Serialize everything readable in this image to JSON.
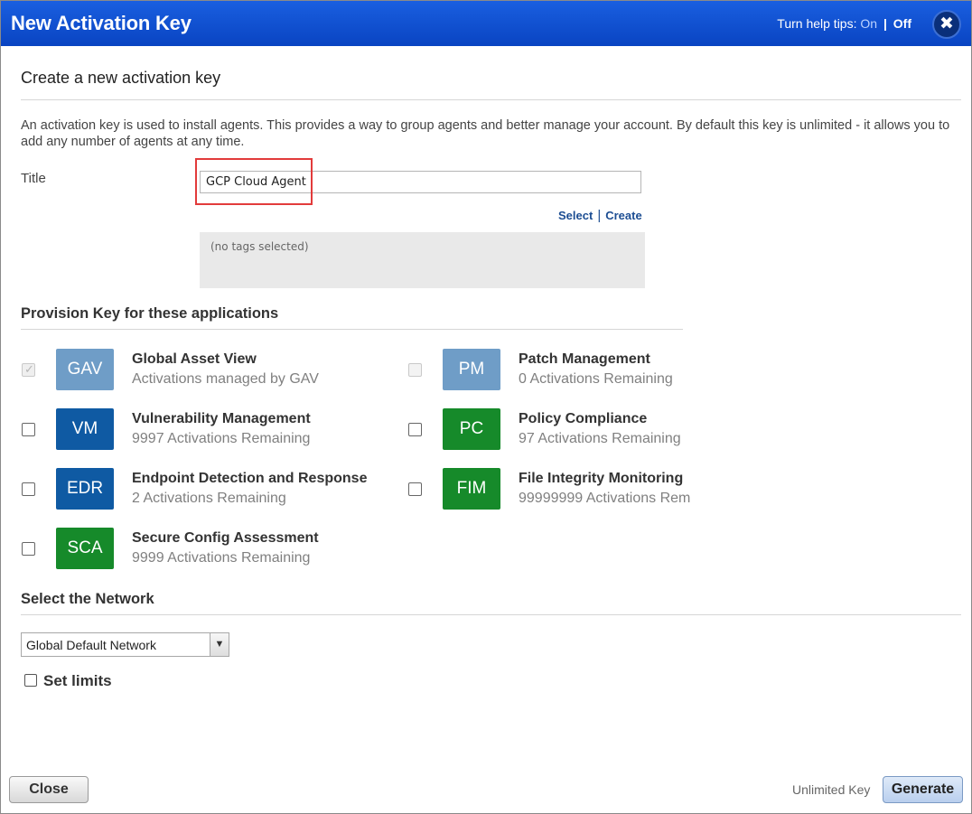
{
  "window": {
    "title": "New Activation Key",
    "help_tips_label": "Turn help tips:",
    "help_on": "On",
    "help_separator": "|",
    "help_off": "Off"
  },
  "section": {
    "heading": "Create a new activation key",
    "description": "An activation key is used to install agents. This provides a way to group agents and better manage your account. By default this key is unlimited - it allows you to add any number of agents at any time."
  },
  "title_field": {
    "label": "Title",
    "value": "GCP Cloud Agent"
  },
  "tags": {
    "select_link": "Select",
    "separator": "|",
    "create_link": "Create",
    "empty_text": "(no tags selected)"
  },
  "provision": {
    "heading": "Provision Key for these applications",
    "apps": [
      {
        "abbr": "GAV",
        "name": "Global Asset View",
        "status": "Activations managed by GAV",
        "color": "#6f9dc7",
        "checkbox": "checked-disabled"
      },
      {
        "abbr": "PM",
        "name": "Patch Management",
        "status": "0 Activations Remaining",
        "color": "#6f9dc7",
        "checkbox": "disabled"
      },
      {
        "abbr": "VM",
        "name": "Vulnerability Management",
        "status": "9997 Activations Remaining",
        "color": "#0f5aa3",
        "checkbox": "unchecked"
      },
      {
        "abbr": "PC",
        "name": "Policy Compliance",
        "status": "97 Activations Remaining",
        "color": "#168a2a",
        "checkbox": "unchecked"
      },
      {
        "abbr": "EDR",
        "name": "Endpoint Detection and Response",
        "status": "2 Activations Remaining",
        "color": "#0f5aa3",
        "checkbox": "unchecked"
      },
      {
        "abbr": "FIM",
        "name": "File Integrity Monitoring",
        "status": "99999999 Activations Rem",
        "color": "#168a2a",
        "checkbox": "unchecked"
      },
      {
        "abbr": "SCA",
        "name": "Secure Config Assessment",
        "status": "9999 Activations Remaining",
        "color": "#168a2a",
        "checkbox": "unchecked"
      }
    ]
  },
  "network": {
    "heading": "Select the Network",
    "selected": "Global Default Network",
    "set_limits_label": "Set limits"
  },
  "footer": {
    "close_label": "Close",
    "key_type": "Unlimited Key",
    "generate_label": "Generate"
  }
}
